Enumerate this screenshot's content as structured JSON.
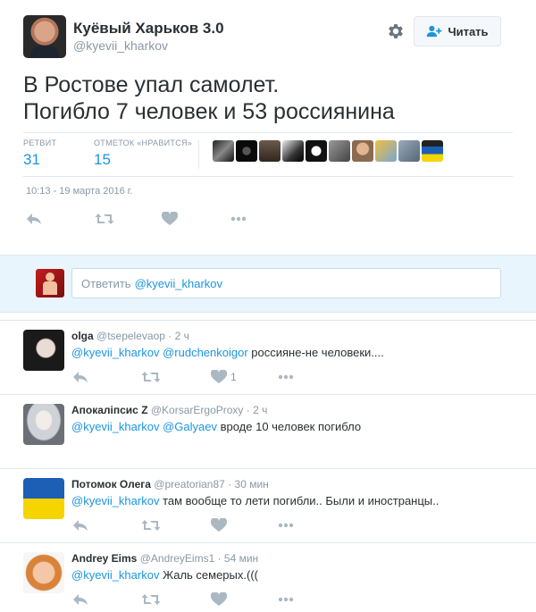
{
  "tweet": {
    "author_name": "Куёвый Харьков 3.0",
    "author_handle": "@kyevii_kharkov",
    "follow_label": "Читать",
    "text_line1": "В Ростове упал самолет.",
    "text_line2": "Погибло 7 человек и 53 россиянина",
    "retweets_label": "РЕТВИТ",
    "retweets_count": "31",
    "likes_label": "ОТМЕТОК «НРАВИТСЯ»",
    "likes_count": "15",
    "timestamp": "10:13 - 19 марта 2016 г.",
    "liker_count_shown": 10
  },
  "reply_box": {
    "placeholder_prefix": "Ответить",
    "placeholder_mention": "@kyevii_kharkov"
  },
  "replies": [
    {
      "name": "olga",
      "handle": "@tsepelevaop",
      "time": "· 2 ч",
      "mention1": "@kyevii_kharkov",
      "mention2": "@rudchenkoigor",
      "text": " россияне-не человеки....",
      "like_count": "1"
    },
    {
      "name": "Апокаліпсис Z",
      "handle": "@KorsarErgoProxy",
      "time": "· 2 ч",
      "mention1": "@kyevii_kharkov",
      "mention2": "@Galyaev",
      "text": " вроде 10 человек погибло",
      "like_count": ""
    },
    {
      "name": "Потомок Олега",
      "handle": "@preatorian87",
      "time": "· 30 мин",
      "mention1": "@kyevii_kharkov",
      "mention2": "",
      "text": " там вообще то лети погибли.. Были и иностранцы..",
      "like_count": ""
    },
    {
      "name": "Andrey Eims",
      "handle": "@AndreyEims1",
      "time": "· 54 мин",
      "mention1": "@kyevii_kharkov",
      "mention2": "",
      "text": " Жаль семерых.(((",
      "like_count": ""
    }
  ],
  "colors": {
    "link": "#1b95e0",
    "muted": "#8899a6",
    "text": "#292f33",
    "reply_bg": "#e8f5fd"
  }
}
